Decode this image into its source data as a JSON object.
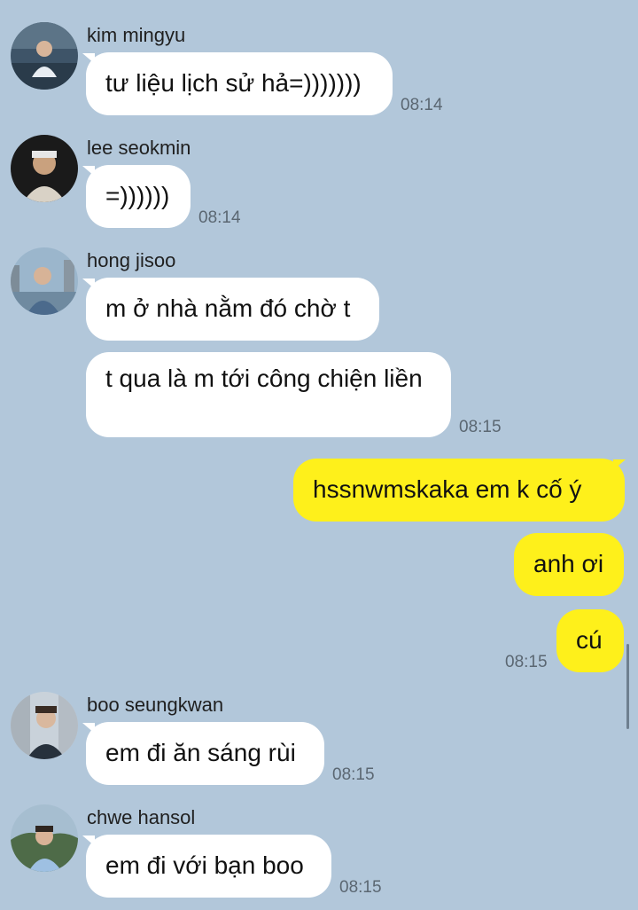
{
  "colors": {
    "background": "#b2c7da",
    "incoming_bubble": "#ffffff",
    "outgoing_bubble": "#fef01b",
    "time_text": "#5b6772"
  },
  "messages": {
    "m1": {
      "sender": "kim mingyu",
      "text": "tư liệu lịch sử hả=)))))))",
      "time": "08:14"
    },
    "m2": {
      "sender": "lee seokmin",
      "text": "=))))))",
      "time": "08:14"
    },
    "m3": {
      "sender": "hong jisoo",
      "text1": "m ở nhà nằm đó chờ t",
      "text2": "t qua là m tới công chiện liền",
      "time": "08:15"
    },
    "me": {
      "text1": "hssnwmskaka em k cố ý",
      "text2": "anh ơi",
      "text3": "cú",
      "time": "08:15"
    },
    "m5": {
      "sender": "boo seungkwan",
      "text": "em đi ăn sáng rùi",
      "time": "08:15"
    },
    "m6": {
      "sender": "chwe hansol",
      "text": "em đi với bạn boo",
      "time": "08:15"
    }
  }
}
